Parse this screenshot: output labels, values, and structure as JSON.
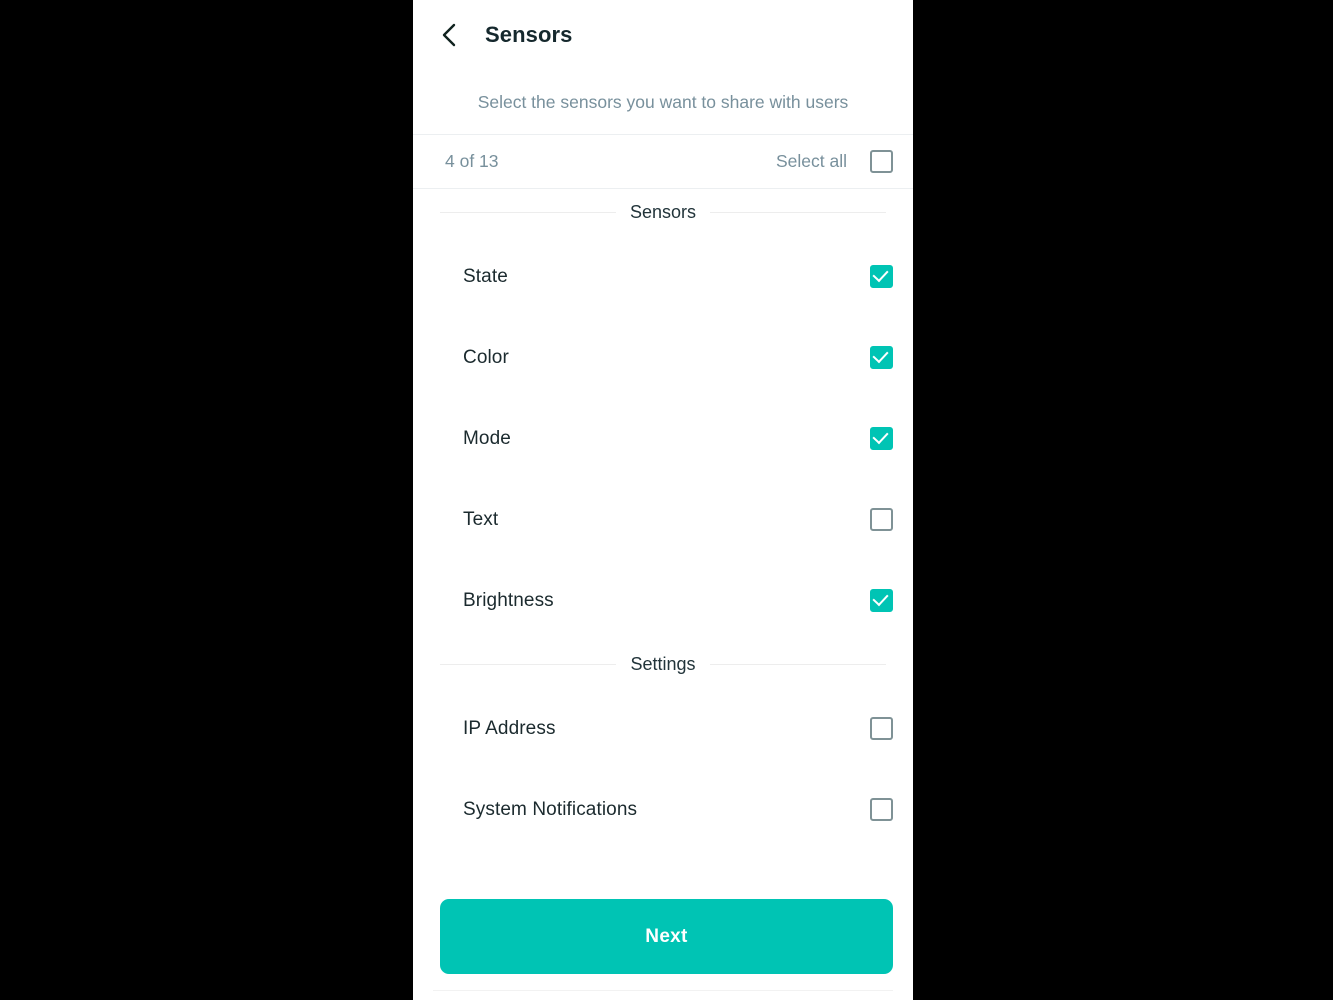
{
  "appbar": {
    "back_icon": "chevron-left-icon",
    "title": "Sensors"
  },
  "subtitle": "Select the sensors you want to share with users",
  "count_bar": {
    "count_text": "4 of 13",
    "select_all_label": "Select all",
    "select_all_checked": false
  },
  "sections": [
    {
      "title": "Sensors",
      "items": [
        {
          "label": "State",
          "checked": true
        },
        {
          "label": "Color",
          "checked": true
        },
        {
          "label": "Mode",
          "checked": true
        },
        {
          "label": "Text",
          "checked": false
        },
        {
          "label": "Brightness",
          "checked": true
        }
      ]
    },
    {
      "title": "Settings",
      "items": [
        {
          "label": "IP Address",
          "checked": false
        },
        {
          "label": "System Notifications",
          "checked": false
        },
        {
          "label": "",
          "checked": false
        }
      ]
    }
  ],
  "bottom": {
    "next_label": "Next"
  },
  "colors": {
    "accent": "#00c4b4",
    "checkbox_border": "#7f9296",
    "muted_text": "#78909c",
    "primary_text": "#1b2a2e",
    "divider": "#eceff1",
    "page_background": "#000000",
    "surface": "#ffffff"
  }
}
